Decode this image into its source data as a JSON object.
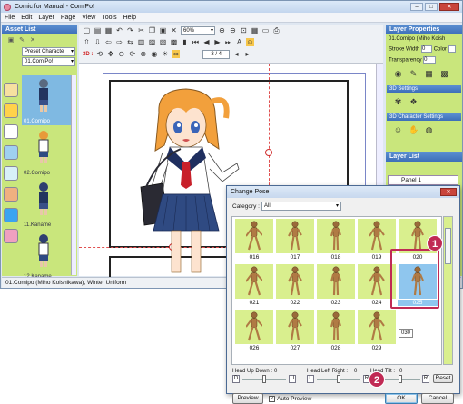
{
  "window": {
    "title": "Comic for Manual - ComiPo!"
  },
  "menu": [
    "File",
    "Edit",
    "Layer",
    "Page",
    "View",
    "Tools",
    "Help"
  ],
  "asset_list": {
    "title": "Asset List",
    "preset_select": "Preset Charactе",
    "char_select": "01.ComiPo!",
    "items": [
      {
        "label": "01.Comipo",
        "selected": true
      },
      {
        "label": "02.Comipo"
      },
      {
        "label": "11.Kaname"
      },
      {
        "label": "12.Kaname"
      }
    ]
  },
  "toolbar": {
    "zoom": "60%",
    "page": "3 / 4",
    "label_3d": "3D :"
  },
  "layer_properties": {
    "title": "Layer Properties",
    "layer_name": "01.Comipo (Miho Koish",
    "stroke_width": "Stroke Width",
    "stroke_value": "0",
    "color": "Color",
    "transparency": "Transparency",
    "transparency_value": "0",
    "settings_3d": "3D Settings",
    "char_settings_3d": "3D Character Settings"
  },
  "layer_list": {
    "title": "Layer List",
    "item": "Panel 1"
  },
  "status_bar": "01.Comipo (Miho Koishikawa), Winter Uniform",
  "dialog": {
    "title": "Change Pose",
    "category_label": "Category :",
    "category_value": "All",
    "poses": [
      "016",
      "017",
      "018",
      "019",
      "020",
      "021",
      "022",
      "023",
      "024",
      "025",
      "026",
      "027",
      "028",
      "029"
    ],
    "selected_pose": "025",
    "tooltip": "030",
    "head_up_down": "Head Up Down :",
    "head_up_down_value": "0",
    "head_left_right": "Head Left Right :",
    "head_left_right_value": "0",
    "head_tilt": "Head Tilt :",
    "head_tilt_value": "0",
    "btn_d": "D",
    "btn_u": "U",
    "btn_l": "L",
    "btn_r": "R",
    "btn_r2": "R",
    "reset": "Reset",
    "preview": "Preview",
    "auto_preview": "Auto Preview",
    "ok": "OK",
    "cancel": "Cancel"
  },
  "callouts": {
    "one": "1",
    "two": "2"
  },
  "colors": {
    "accent_green": "#c9e67c",
    "panel_blue": "#3d6fb8",
    "callout": "#c02a54",
    "selected": "#8fc6ee"
  }
}
